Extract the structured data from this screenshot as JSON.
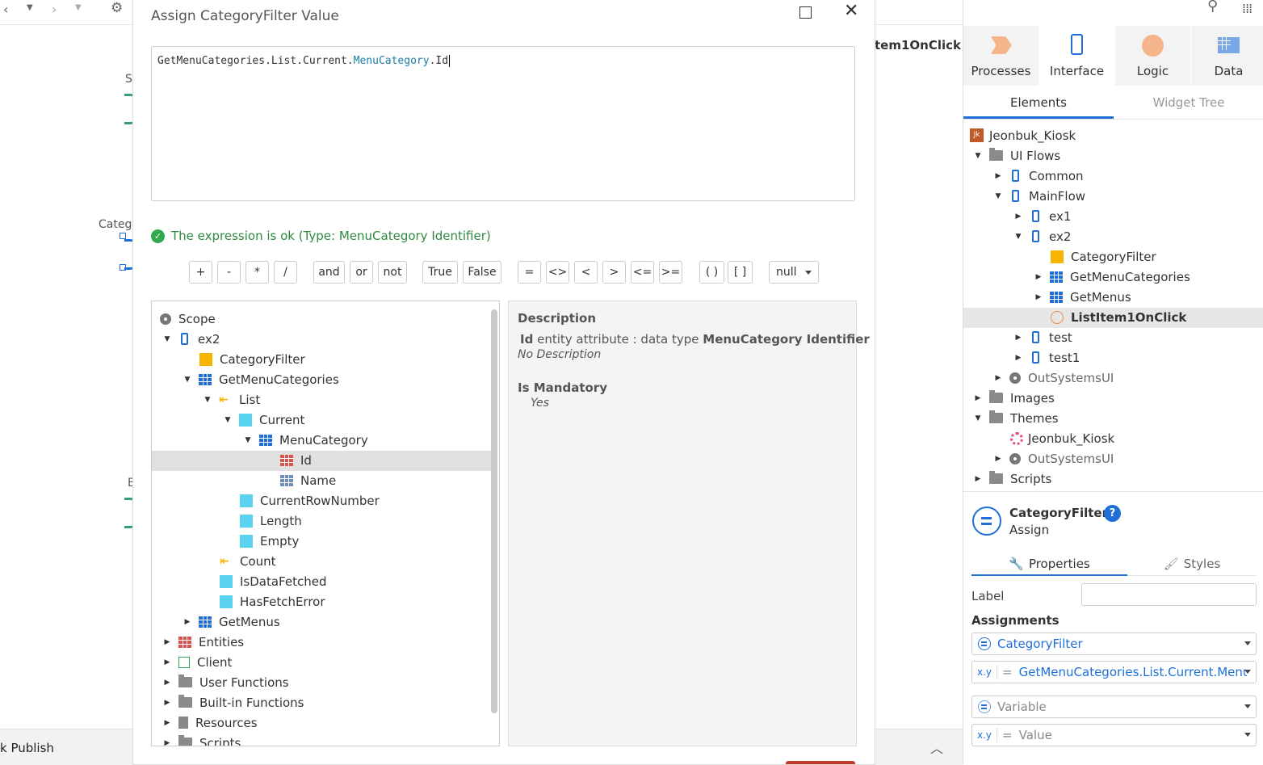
{
  "toolbar": {
    "settings_icon": "gear-icon",
    "search_icon": "search-icon",
    "apps_icon": "apps-grid-icon"
  },
  "canvas": {
    "frag_s": "S",
    "frag_categ": "Categ",
    "frag_e": "E",
    "flow_title": "tem1OnClick",
    "publish_label": "k Publish"
  },
  "dialog": {
    "title": "Assign CategoryFilter Value",
    "expression": {
      "part1": "GetMenuCategories.List.Current.",
      "part2": "MenuCategory",
      "part3": ".Id"
    },
    "status": "The expression is ok (Type: MenuCategory Identifier)",
    "operators": [
      "+",
      "-",
      "*",
      "/",
      "and",
      "or",
      "not",
      "True",
      "False",
      "=",
      "<>",
      "<",
      ">",
      "<=",
      ">=",
      "( )",
      "[ ]"
    ],
    "null_select": "null",
    "scope_tree": [
      {
        "label": "Scope"
      },
      {
        "label": "ex2"
      },
      {
        "label": "CategoryFilter"
      },
      {
        "label": "GetMenuCategories"
      },
      {
        "label": "List"
      },
      {
        "label": "Current"
      },
      {
        "label": "MenuCategory"
      },
      {
        "label": "Id"
      },
      {
        "label": "Name"
      },
      {
        "label": "CurrentRowNumber"
      },
      {
        "label": "Length"
      },
      {
        "label": "Empty"
      },
      {
        "label": "Count"
      },
      {
        "label": "IsDataFetched"
      },
      {
        "label": "HasFetchError"
      },
      {
        "label": "GetMenus"
      },
      {
        "label": "Entities"
      },
      {
        "label": "Client"
      },
      {
        "label": "User Functions"
      },
      {
        "label": "Built-in Functions"
      },
      {
        "label": "Resources"
      },
      {
        "label": "Scripts"
      }
    ],
    "description": {
      "heading": "Description",
      "name": "Id",
      "text_mid": " entity attribute : data type ",
      "type": "MenuCategory Identifier",
      "no_desc": "No Description",
      "mandatory_heading": "Is Mandatory",
      "mandatory_value": "Yes"
    }
  },
  "rightpanel": {
    "tabs": [
      "Processes",
      "Interface",
      "Logic",
      "Data"
    ],
    "subtabs": [
      "Elements",
      "Widget Tree"
    ],
    "tree": [
      {
        "label": "Jeonbuk_Kiosk",
        "badge": "Jk"
      },
      {
        "label": "UI Flows"
      },
      {
        "label": "Common"
      },
      {
        "label": "MainFlow"
      },
      {
        "label": "ex1"
      },
      {
        "label": "ex2"
      },
      {
        "label": "CategoryFilter"
      },
      {
        "label": "GetMenuCategories"
      },
      {
        "label": "GetMenus"
      },
      {
        "label": "ListItem1OnClick"
      },
      {
        "label": "test"
      },
      {
        "label": "test1"
      },
      {
        "label": "OutSystemsUI"
      },
      {
        "label": "Images"
      },
      {
        "label": "Themes"
      },
      {
        "label": "Jeonbuk_Kiosk"
      },
      {
        "label": "OutSystemsUI"
      },
      {
        "label": "Scripts"
      }
    ],
    "props": {
      "title": "CategoryFilter",
      "subtitle": "Assign",
      "help": "?",
      "tab_properties": "Properties",
      "tab_styles": "Styles",
      "label_label": "Label",
      "assignments_label": "Assignments",
      "assign1_var": "CategoryFilter",
      "assign1_xy": "x.y",
      "assign1_eq": "=",
      "assign1_value": "GetMenuCategories.List.Current.MenuC",
      "assign2_var": "Variable",
      "assign2_xy": "x.y",
      "assign2_eq": "=",
      "assign2_value": "Value"
    }
  }
}
